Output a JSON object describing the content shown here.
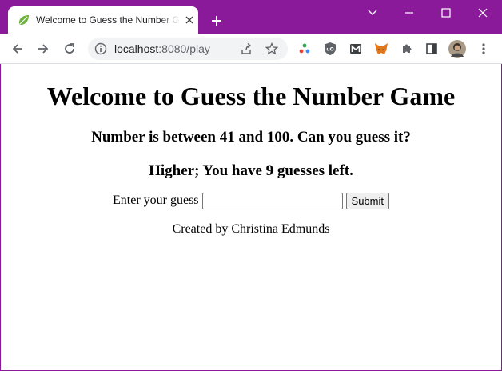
{
  "browser": {
    "tab_title": "Welcome to Guess the Number Game",
    "url_host": "localhost",
    "url_port_path": ":8080/play",
    "colors": {
      "frame": "#8b1a9b",
      "favicon": "#6db33f"
    },
    "icons": {
      "favicon": "spring-leaf-icon",
      "tab_close": "close-icon",
      "new_tab": "plus-icon",
      "tab_search": "chevron-down-icon",
      "minimize": "minimize-icon",
      "maximize": "maximize-icon",
      "close_window": "close-icon",
      "back": "arrow-left-icon",
      "forward": "arrow-right-icon",
      "reload": "reload-icon",
      "site_info": "info-icon",
      "share": "share-icon",
      "bookmark": "star-icon",
      "extensions": [
        "color-dots-extension-icon",
        "ublock-shield-icon",
        "gmail-m-icon",
        "metamask-fox-icon",
        "puzzle-icon",
        "side-panel-icon",
        "avatar",
        "kebab-menu-icon"
      ]
    }
  },
  "page": {
    "title": "Welcome to Guess the Number Game",
    "range_text": "Number is between 41 and 100. Can you guess it?",
    "hint_text": "Higher; You have 9 guesses left.",
    "form": {
      "label": "Enter your guess",
      "input_value": "",
      "submit_label": "Submit"
    },
    "footer": "Created by Christina Edmunds"
  }
}
